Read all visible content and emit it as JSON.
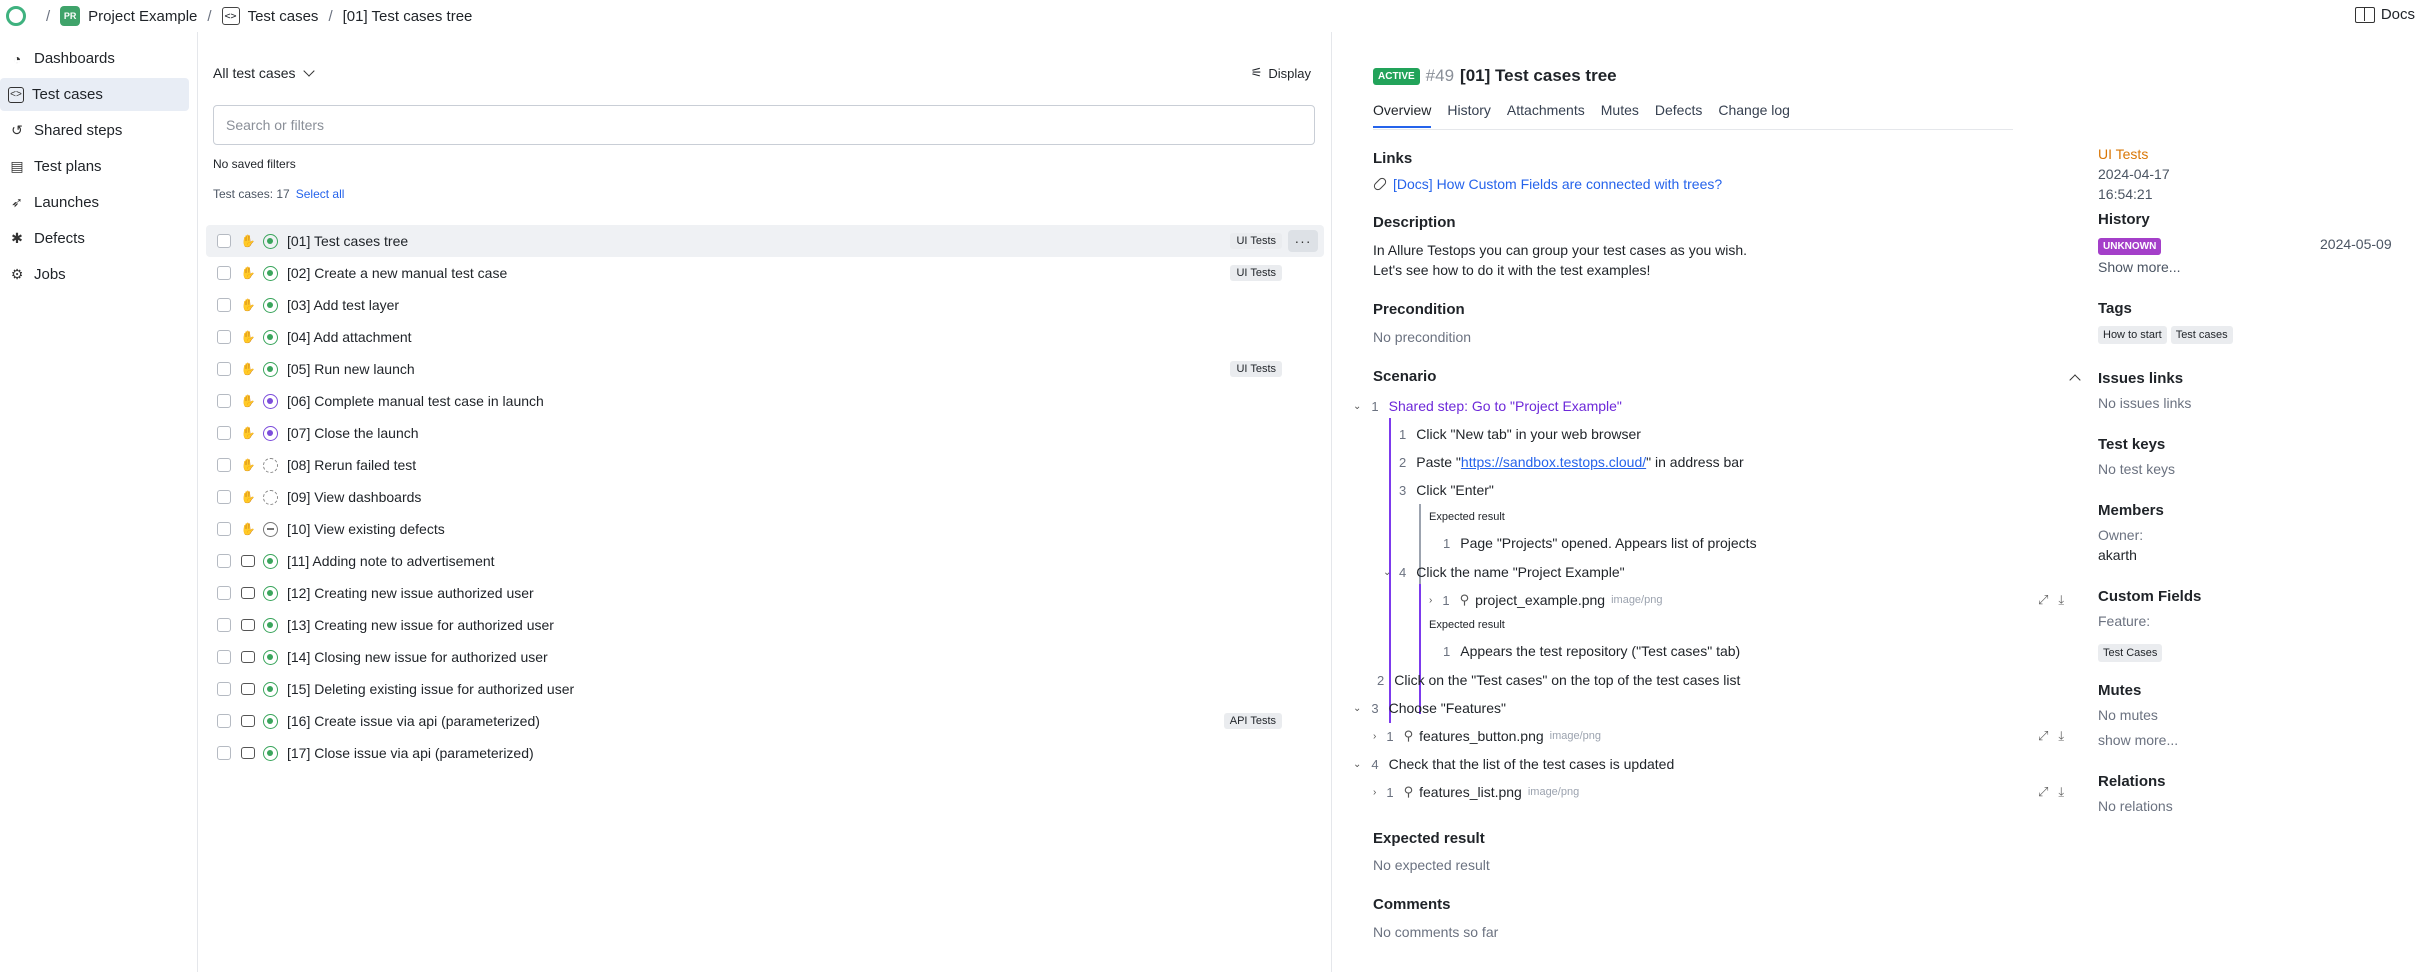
{
  "breadcrumb": {
    "project_badge": "PR",
    "project_name": "Project Example",
    "section": "Test cases",
    "current": "[01] Test cases tree",
    "docs_label": "Docs"
  },
  "sidebar": {
    "items": [
      {
        "label": "Dashboards",
        "icon": "gauge-icon"
      },
      {
        "label": "Test cases",
        "icon": "code-brackets-icon"
      },
      {
        "label": "Shared steps",
        "icon": "shared-steps-icon"
      },
      {
        "label": "Test plans",
        "icon": "clipboard-icon"
      },
      {
        "label": "Launches",
        "icon": "rocket-icon"
      },
      {
        "label": "Defects",
        "icon": "bug-icon"
      },
      {
        "label": "Jobs",
        "icon": "jobs-icon"
      }
    ]
  },
  "list": {
    "filter_label": "All test cases",
    "display_label": "Display",
    "search_placeholder": "Search or filters",
    "no_saved_filters": "No saved filters",
    "count_label": "Test cases: 17",
    "select_all": "Select all",
    "rows": [
      {
        "label": "[01] Test cases tree",
        "type": "manual",
        "status": "active",
        "tag": "UI Tests"
      },
      {
        "label": "[02] Create a new manual test case",
        "type": "manual",
        "status": "active",
        "tag": "UI Tests"
      },
      {
        "label": "[03] Add test layer",
        "type": "manual",
        "status": "active",
        "tag": ""
      },
      {
        "label": "[04] Add attachment",
        "type": "manual",
        "status": "active",
        "tag": ""
      },
      {
        "label": "[05] Run new launch",
        "type": "manual",
        "status": "active",
        "tag": "UI Tests"
      },
      {
        "label": "[06] Complete manual test case in launch",
        "type": "manual",
        "status": "review",
        "tag": ""
      },
      {
        "label": "[07] Close the launch",
        "type": "manual",
        "status": "review",
        "tag": ""
      },
      {
        "label": "[08] Rerun failed test",
        "type": "manual",
        "status": "draft",
        "tag": ""
      },
      {
        "label": "[09] View dashboards",
        "type": "manual",
        "status": "draft",
        "tag": ""
      },
      {
        "label": "[10] View existing defects",
        "type": "manual",
        "status": "deprecated",
        "tag": ""
      },
      {
        "label": "[11] Adding note to advertisement",
        "type": "auto",
        "status": "active",
        "tag": ""
      },
      {
        "label": "[12] Creating new issue authorized user",
        "type": "auto",
        "status": "active",
        "tag": ""
      },
      {
        "label": "[13] Creating new issue for authorized user",
        "type": "auto",
        "status": "active",
        "tag": ""
      },
      {
        "label": "[14] Closing new issue for authorized user",
        "type": "auto",
        "status": "active",
        "tag": ""
      },
      {
        "label": "[15] Deleting existing issue for authorized user",
        "type": "auto",
        "status": "active",
        "tag": ""
      },
      {
        "label": "[16] Create issue via api (parameterized)",
        "type": "auto",
        "status": "active",
        "tag": "API Tests"
      },
      {
        "label": "[17] Close issue via api (parameterized)",
        "type": "auto",
        "status": "active",
        "tag": ""
      }
    ]
  },
  "details": {
    "status_badge": "ACTIVE",
    "id": "#49",
    "name": "[01] Test cases tree",
    "tabs": [
      "Overview",
      "History",
      "Attachments",
      "Mutes",
      "Defects",
      "Change log"
    ],
    "links_heading": "Links",
    "link_text": "[Docs] How Custom Fields are connected with trees?",
    "description_heading": "Description",
    "description_line1": "In Allure Testops you can group your test cases as you wish.",
    "description_line2": "Let's see how to do it with the test examples!",
    "precondition_heading": "Precondition",
    "precondition_text": "No precondition",
    "scenario_heading": "Scenario",
    "shared_step": "Shared step: Go to \"Project Example\"",
    "sub1": "Click \"New tab\" in your web browser",
    "sub2_pre": "Paste \"",
    "sub2_link": "https://sandbox.testops.cloud/",
    "sub2_post": "\" in address bar",
    "sub3": "Click \"Enter\"",
    "expected_label": "Expected result",
    "sub3_expected": "Page \"Projects\" opened. Appears list of projects",
    "sub4": "Click the name \"Project Example\"",
    "att1_name": "project_example.png",
    "att_type": "image/png",
    "sub4_expected": "Appears the test repository (\"Test cases\" tab)",
    "step2": "Click on the \"Test cases\" on the top of the test cases list",
    "step3": "Choose \"Features\"",
    "att2_name": "features_button.png",
    "step4": "Check that the list of the test cases is updated",
    "att3_name": "features_list.png",
    "expected_heading": "Expected result",
    "expected_text": "No expected result",
    "comments_heading": "Comments",
    "comments_text": "No comments so far"
  },
  "right": {
    "layer": "UI Tests",
    "date": "2024-04-17",
    "time": "16:54:21",
    "history_heading": "History",
    "history_badge": "UNKNOWN",
    "history_date": "2024-05-09",
    "show_more": "Show more...",
    "tags_heading": "Tags",
    "tags": [
      "How to start",
      "Test cases"
    ],
    "issues_heading": "Issues links",
    "issues_text": "No issues links",
    "keys_heading": "Test keys",
    "keys_text": "No test keys",
    "members_heading": "Members",
    "owner_label": "Owner:",
    "owner_name": "akarth",
    "cf_heading": "Custom Fields",
    "feature_label": "Feature:",
    "feature_value": "Test Cases",
    "mutes_heading": "Mutes",
    "mutes_text": "No mutes",
    "mutes_more": "show more...",
    "relations_heading": "Relations",
    "relations_text": "No relations"
  },
  "colors": {
    "accent": "#2563eb",
    "active": "#22a35a",
    "review": "#7c4ddb",
    "unknown": "#a43fc9",
    "layer": "#d97706"
  }
}
